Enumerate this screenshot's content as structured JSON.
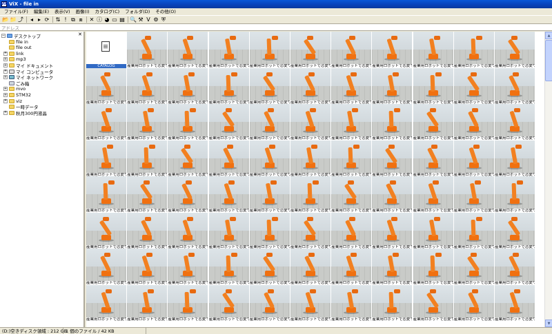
{
  "window": {
    "title": "ViX - file in",
    "app_icon_text": "ViX"
  },
  "menu": [
    {
      "label": "ファイル(F)"
    },
    {
      "label": "編集(E)"
    },
    {
      "label": "表示(V)"
    },
    {
      "label": "画像(I)"
    },
    {
      "label": "カタログ(C)"
    },
    {
      "label": "フォルダ(D)"
    },
    {
      "label": "その他(O)"
    }
  ],
  "toolbar": {
    "buttons": [
      {
        "icon": "open-folder-icon",
        "glyph": "📂"
      },
      {
        "icon": "new-folder-icon",
        "glyph": "📁"
      },
      {
        "icon": "up-folder-icon",
        "glyph": "⤴"
      },
      {
        "icon": "back-icon",
        "glyph": "◂"
      },
      {
        "icon": "forward-icon",
        "glyph": "▸"
      },
      {
        "icon": "refresh-icon",
        "glyph": "⟳"
      },
      {
        "icon": "sort-icon",
        "glyph": "⇅"
      },
      {
        "icon": "mark-icon",
        "glyph": "!"
      },
      {
        "icon": "copy-icon",
        "glyph": "⧉"
      },
      {
        "icon": "move-icon",
        "glyph": "⧈"
      },
      {
        "icon": "delete-icon",
        "glyph": "✕"
      },
      {
        "icon": "info-icon",
        "glyph": "ⓘ"
      },
      {
        "icon": "globe-icon",
        "glyph": "◕"
      },
      {
        "icon": "slideshow-icon",
        "glyph": "▭"
      },
      {
        "icon": "view-icon",
        "glyph": "▤"
      },
      {
        "icon": "magnify-icon",
        "glyph": "🔍"
      },
      {
        "icon": "tools-icon",
        "glyph": "⚒"
      },
      {
        "icon": "vix-icon",
        "glyph": "V"
      },
      {
        "icon": "settings-icon",
        "glyph": "⚙"
      },
      {
        "icon": "shield-icon",
        "glyph": "⛨"
      }
    ]
  },
  "address": {
    "label": "アドレス"
  },
  "tree": {
    "items": [
      {
        "label": "デスクトップ",
        "type": "desktop",
        "expander": "−",
        "indent": 0
      },
      {
        "label": "file in",
        "type": "folder",
        "expander": "",
        "indent": 1
      },
      {
        "label": "file out",
        "type": "folder",
        "expander": "",
        "indent": 1
      },
      {
        "label": "link",
        "type": "folder",
        "expander": "+",
        "indent": 1
      },
      {
        "label": "mp3",
        "type": "folder",
        "expander": "+",
        "indent": 1
      },
      {
        "label": "マイ ドキュメント",
        "type": "folder",
        "expander": "+",
        "indent": 1
      },
      {
        "label": "マイ コンピュータ",
        "type": "computer",
        "expander": "+",
        "indent": 1
      },
      {
        "label": "マイ ネットワーク",
        "type": "network",
        "expander": "+",
        "indent": 1
      },
      {
        "label": "ごみ箱",
        "type": "trash",
        "expander": "",
        "indent": 1
      },
      {
        "label": "mvo",
        "type": "folder",
        "expander": "+",
        "indent": 1
      },
      {
        "label": "STM32",
        "type": "folder",
        "expander": "+",
        "indent": 1
      },
      {
        "label": "viz",
        "type": "folder",
        "expander": "+",
        "indent": 1
      },
      {
        "label": "一時データ",
        "type": "folder",
        "expander": "",
        "indent": 1
      },
      {
        "label": "秋月300円液晶",
        "type": "folder",
        "expander": "+",
        "indent": 1
      }
    ]
  },
  "thumbnails": {
    "catalog_label": "CATALOG",
    "caption": "産業用ロボットで恋愛サーキッ"
  },
  "status": {
    "disk": "(D:)空きディスク領域 : 212 GB",
    "files": "1 個のファイル / 42 KB"
  }
}
